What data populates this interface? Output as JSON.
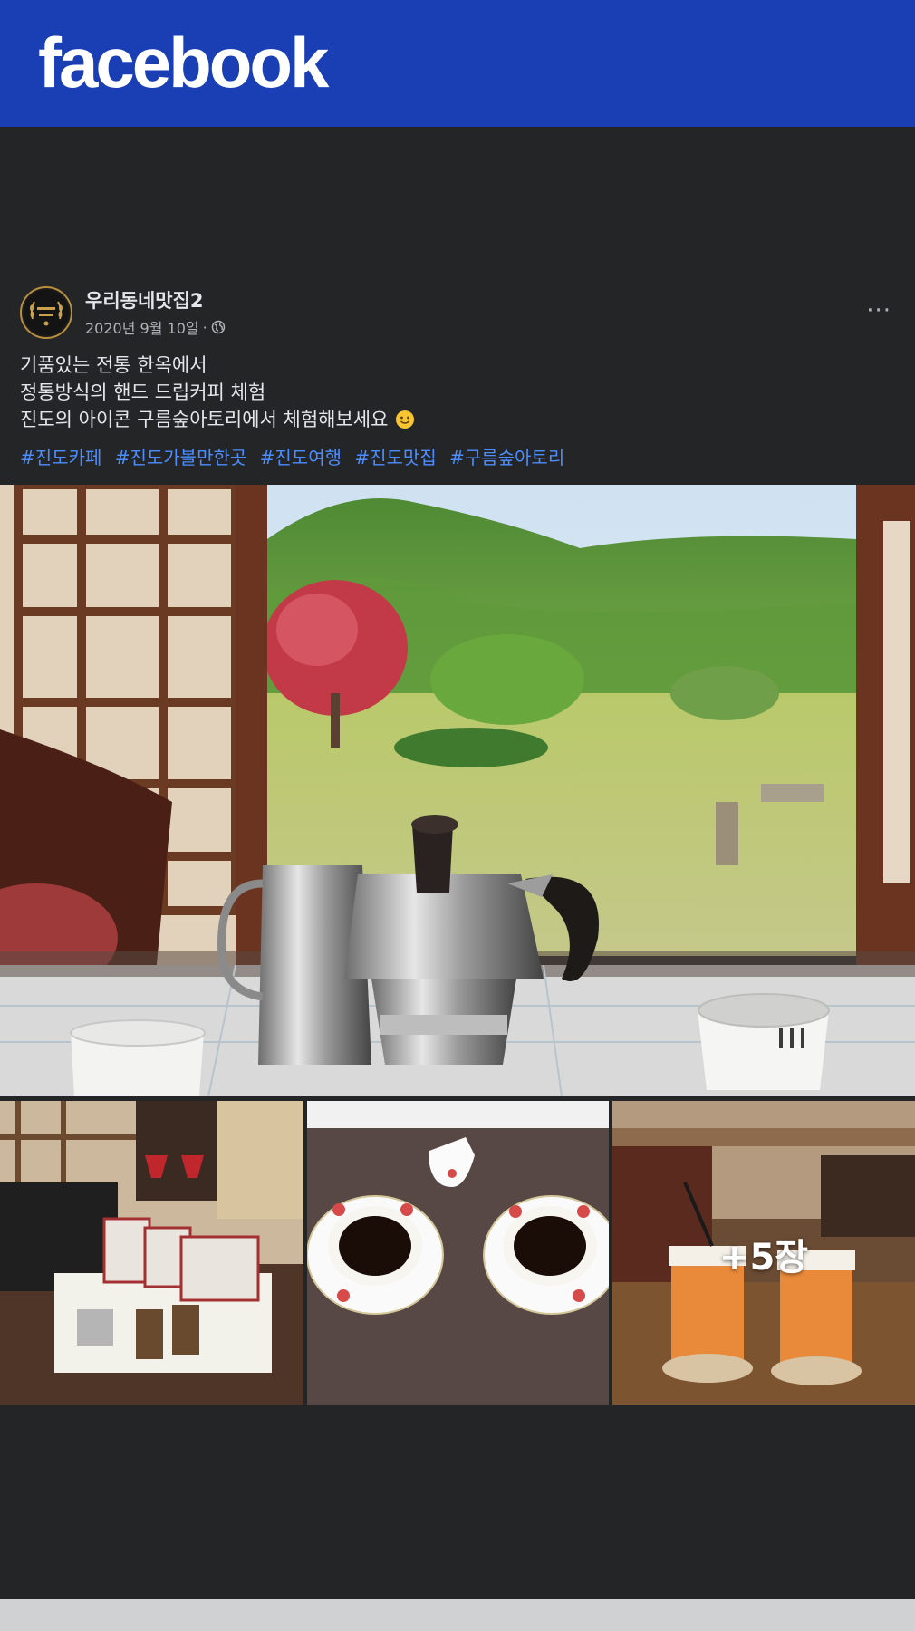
{
  "app": {
    "logo_text": "facebook",
    "brand_color": "#1a3fb5"
  },
  "post": {
    "author": "우리동네맛집2",
    "date": "2020년 9월 10일",
    "separator": "·",
    "privacy_icon": "globe-icon",
    "more_label": "···",
    "avatar_icon": "laurel-badge-avatar",
    "text_lines": [
      "기품있는 전통 한옥에서",
      "정통방식의 핸드 드립커피 체험",
      "진도의 아이콘 구름숲아토리에서 체험해보세요"
    ],
    "emoji": "smile-emoji-icon",
    "hashtags": [
      "#진도카페",
      "#진도가볼만한곳",
      "#진도여행",
      "#진도맛집",
      "#구름숲아토리"
    ],
    "hashtag_color": "#4c8dff"
  },
  "gallery": {
    "main_photo": "hanok-window-view-moka-pot-photo",
    "thumbnails": [
      "coffee-gift-set-photo",
      "coffee-cups-saucers-photo",
      "takeout-coffee-cups-photo"
    ],
    "more_count": "+5장"
  }
}
